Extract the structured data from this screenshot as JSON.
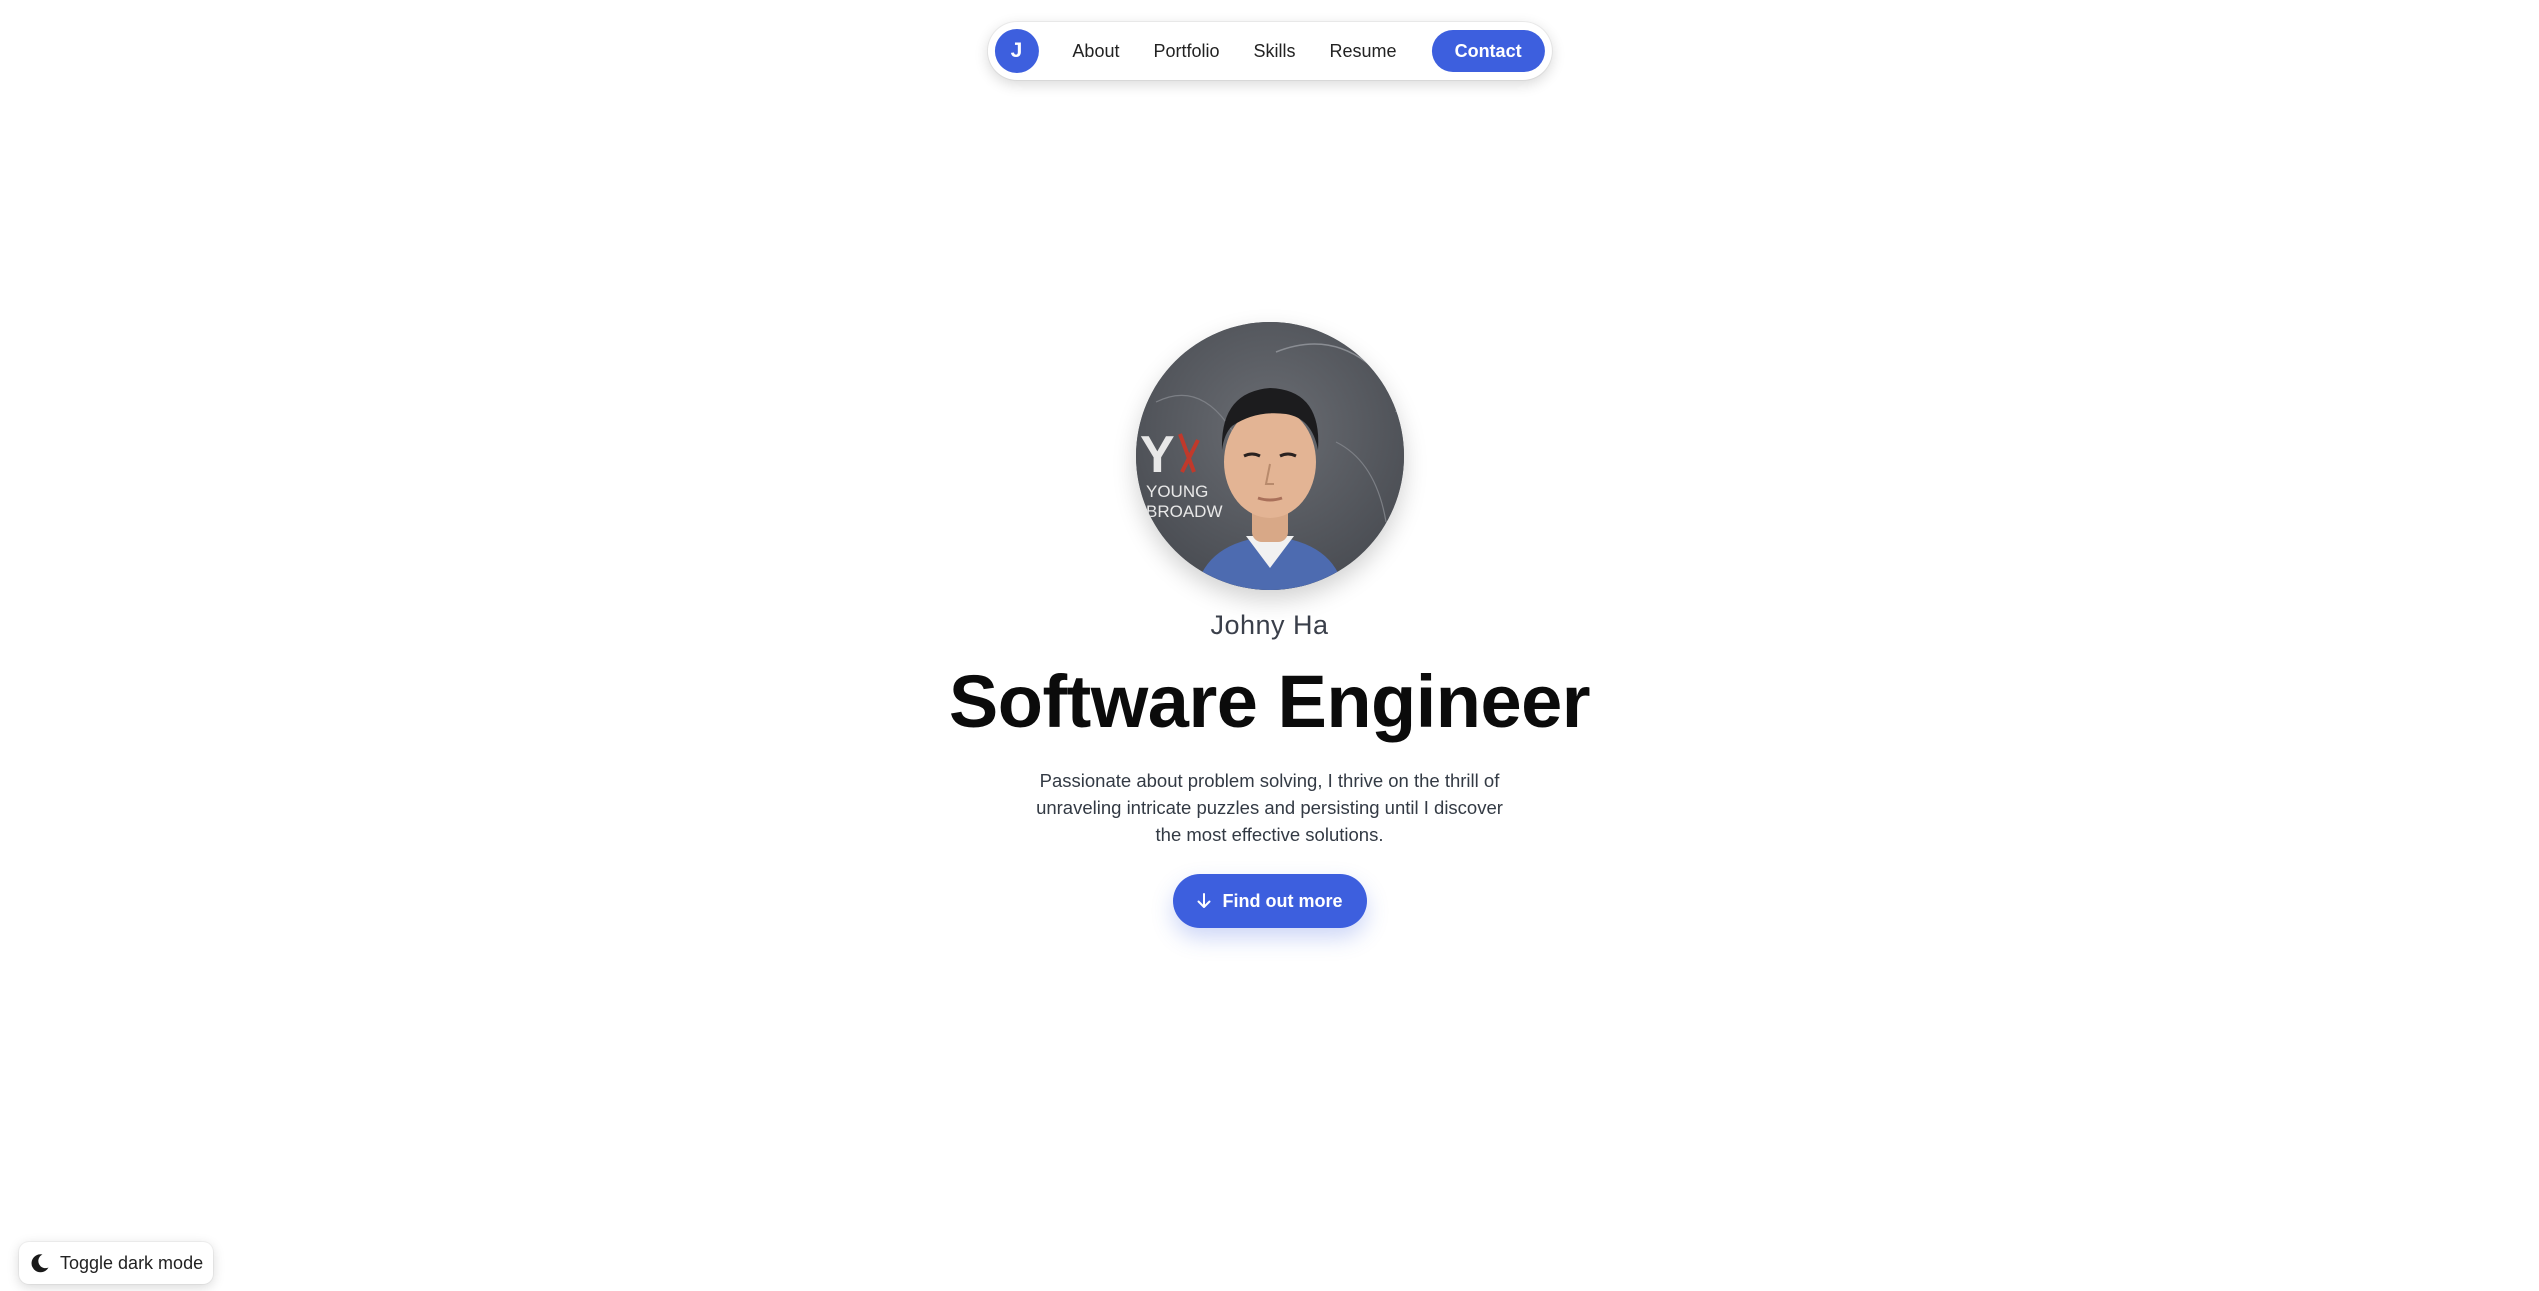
{
  "nav": {
    "logo_letter": "J",
    "links": [
      {
        "label": "About"
      },
      {
        "label": "Portfolio"
      },
      {
        "label": "Skills"
      },
      {
        "label": "Resume"
      }
    ],
    "contact_label": "Contact"
  },
  "hero": {
    "avatar_icon": "profile-photo",
    "photo_backdrop_text": [
      "YOUNG",
      "BROADW"
    ],
    "name": "Johny Ha",
    "title": "Software Engineer",
    "bio_lines": [
      "Passionate about problem solving, I thrive on the thrill of",
      "unraveling intricate puzzles and persisting until I discover",
      "the most effective solutions."
    ],
    "cta_label": "Find out more",
    "cta_icon": "arrow-down-icon"
  },
  "toggle": {
    "label": "Toggle dark mode",
    "icon": "moon-icon"
  },
  "colors": {
    "accent": "#3d5fde",
    "text": "#111111",
    "muted": "#333a44",
    "background": "#ffffff"
  }
}
